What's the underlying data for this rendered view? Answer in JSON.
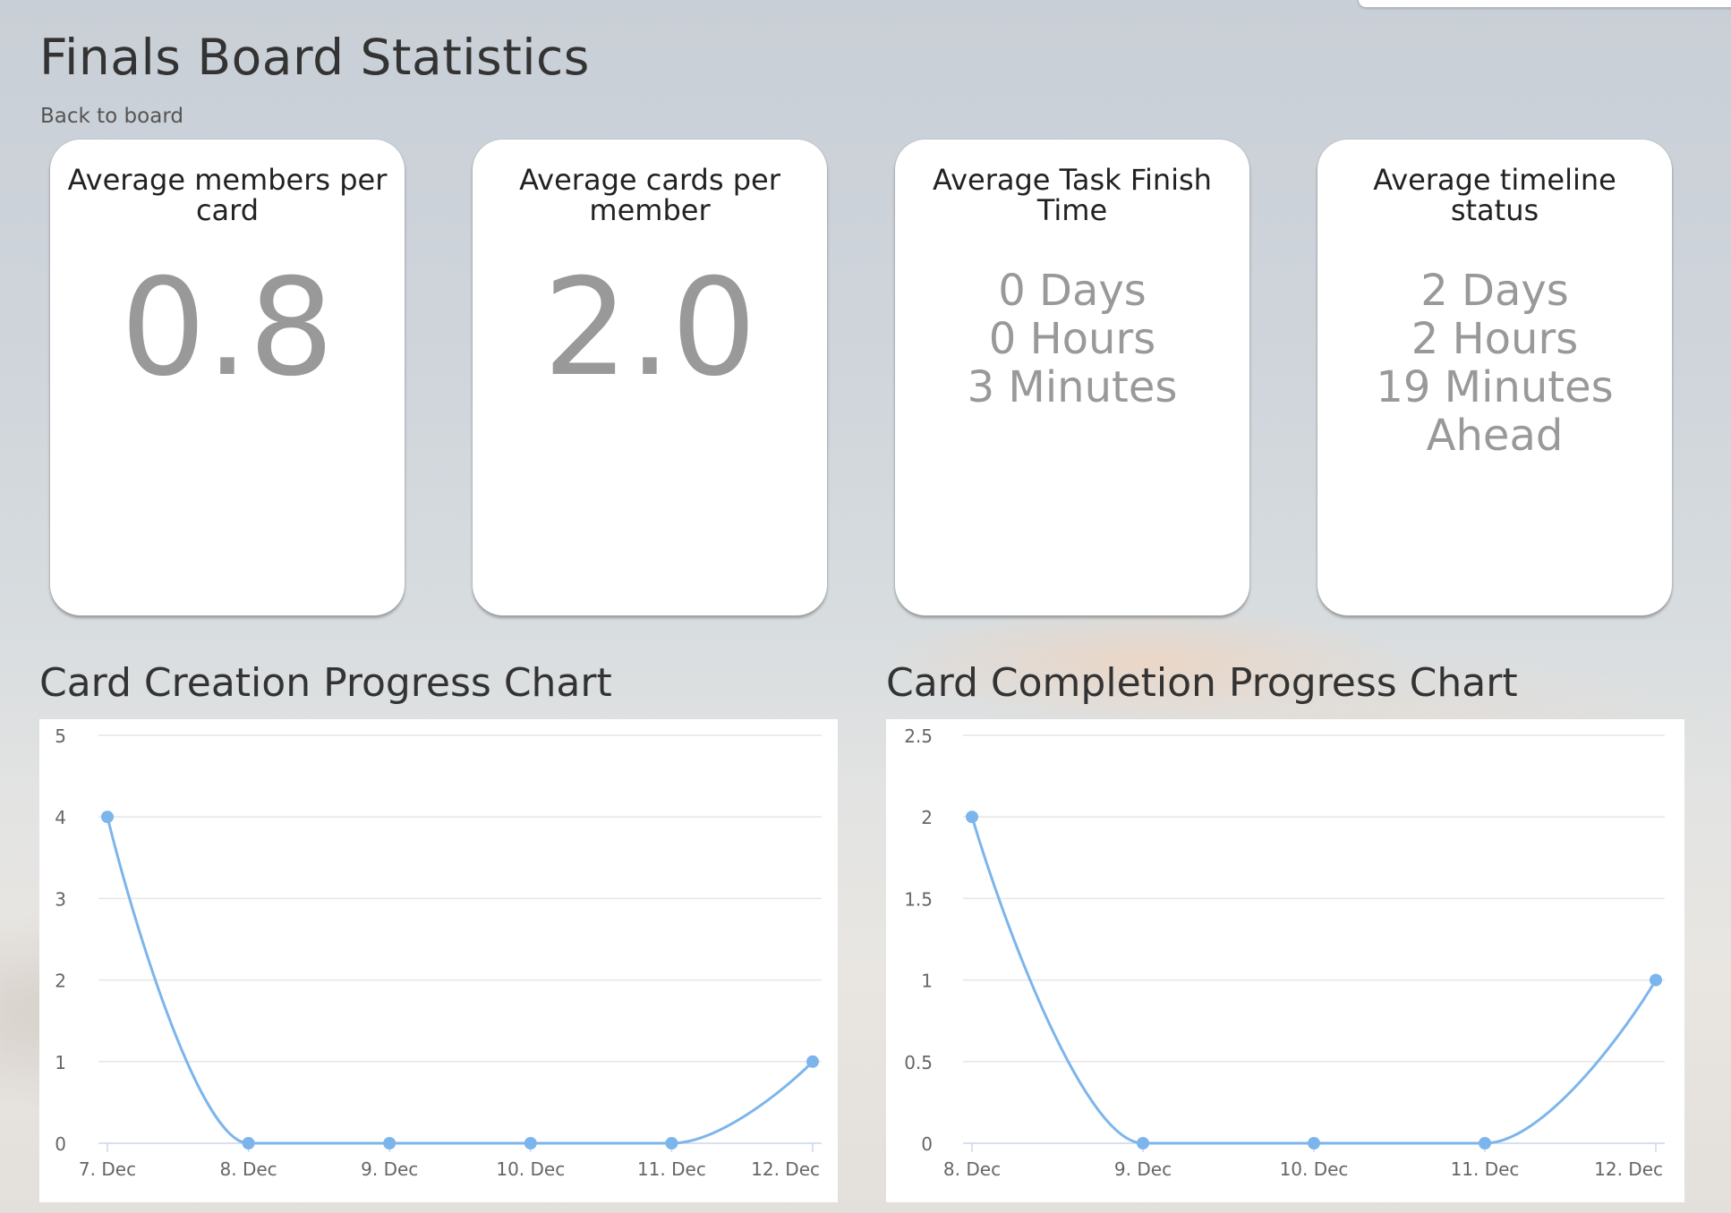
{
  "page": {
    "title": "Finals Board Statistics",
    "back_link": "Back to board"
  },
  "stats": [
    {
      "title": "Average members per card",
      "value": "0.8"
    },
    {
      "title": "Average cards per member",
      "value": "2.0"
    },
    {
      "title": "Average Task Finish Time",
      "lines": [
        "0 Days",
        "0 Hours",
        "3 Minutes"
      ]
    },
    {
      "title": "Average timeline status",
      "lines": [
        "2 Days",
        "2 Hours",
        "19 Minutes",
        "Ahead"
      ]
    }
  ],
  "charts": {
    "creation_title": "Card Creation Progress Chart",
    "completion_title": "Card Completion Progress Chart"
  },
  "colors": {
    "series": "#7cb5ec",
    "grid": "#e6e6e6",
    "axis_line": "#ccd6eb"
  },
  "chart_data": [
    {
      "type": "line",
      "title": "Card Creation Progress Chart",
      "categories": [
        "7. Dec",
        "8. Dec",
        "9. Dec",
        "10. Dec",
        "11. Dec",
        "12. Dec"
      ],
      "x_days": [
        7,
        8,
        9,
        10,
        11,
        12
      ],
      "values": [
        4,
        0,
        0,
        0,
        0,
        1
      ],
      "ylim": [
        0,
        5
      ],
      "yticks": [
        0,
        1,
        2,
        3,
        4,
        5
      ],
      "ytick_labels": [
        "0",
        "1",
        "2",
        "3",
        "4",
        "5"
      ],
      "grid": true,
      "legend": "none"
    },
    {
      "type": "line",
      "title": "Card Completion Progress Chart",
      "categories": [
        "8. Dec",
        "9. Dec",
        "10. Dec",
        "11. Dec",
        "12. Dec"
      ],
      "x_days": [
        8,
        9,
        10,
        11,
        12
      ],
      "values": [
        2,
        0,
        0,
        0,
        1
      ],
      "ylim": [
        0,
        2.5
      ],
      "yticks": [
        0,
        0.5,
        1,
        1.5,
        2,
        2.5
      ],
      "ytick_labels": [
        "0",
        "0.5",
        "1",
        "1.5",
        "2",
        "2.5"
      ],
      "grid": true,
      "legend": "none"
    }
  ]
}
